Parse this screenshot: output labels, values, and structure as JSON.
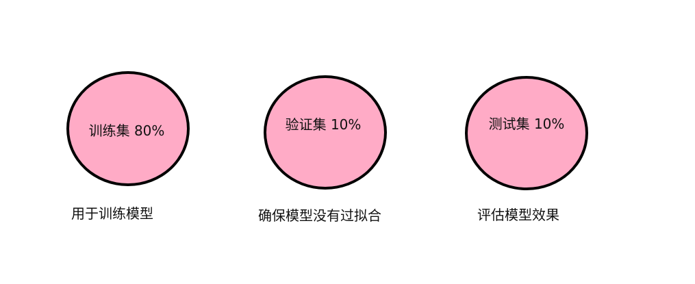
{
  "diagram": {
    "nodes": [
      {
        "label": "训练集 80%",
        "caption": "用于训练模型"
      },
      {
        "label": "验证集 10%",
        "caption": "确保模型没有过拟合"
      },
      {
        "label": "测试集 10%",
        "caption": "评估模型效果"
      }
    ],
    "colors": {
      "fill": "#ffabc6",
      "stroke": "#000000"
    }
  }
}
